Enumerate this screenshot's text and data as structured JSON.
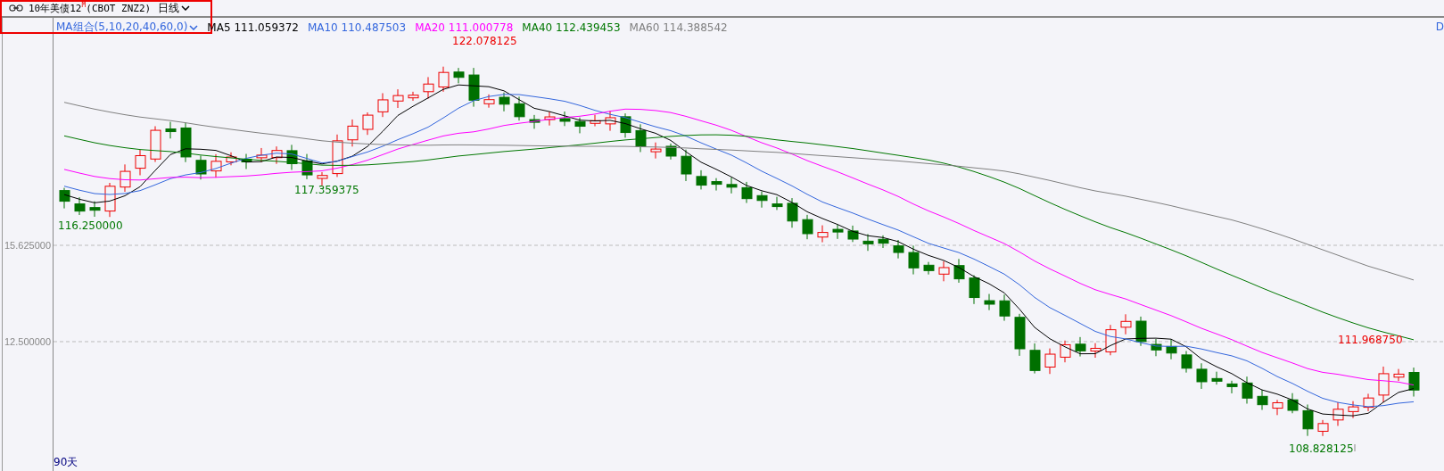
{
  "title": {
    "name": "10年美债12",
    "mark": "M",
    "code": "(CBOT ZNZ2)",
    "period": "日线"
  },
  "legend": {
    "group": "MA组合(5,10,20,40,60,0)",
    "items": [
      {
        "name": "MA5",
        "value": "111.059372",
        "color": "#000000"
      },
      {
        "name": "MA10",
        "value": "110.487503",
        "color": "#3366dd"
      },
      {
        "name": "MA20",
        "value": "111.000778",
        "color": "#ff00ff"
      },
      {
        "name": "MA40",
        "value": "112.439453",
        "color": "#007700"
      },
      {
        "name": "MA60",
        "value": "114.388542",
        "color": "#808080"
      }
    ]
  },
  "axis": {
    "ticks": [
      "15.625000",
      "12.500000"
    ]
  },
  "chart": {
    "labels": [
      {
        "text": "122.078125",
        "kind": "high"
      },
      {
        "text": "117.359375",
        "kind": "low"
      },
      {
        "text": "116.250000",
        "kind": "low"
      },
      {
        "text": "111.968750",
        "kind": "high"
      },
      {
        "text": "108.828125",
        "kind": "low"
      }
    ],
    "span": "90天",
    "edge": "D"
  }
}
